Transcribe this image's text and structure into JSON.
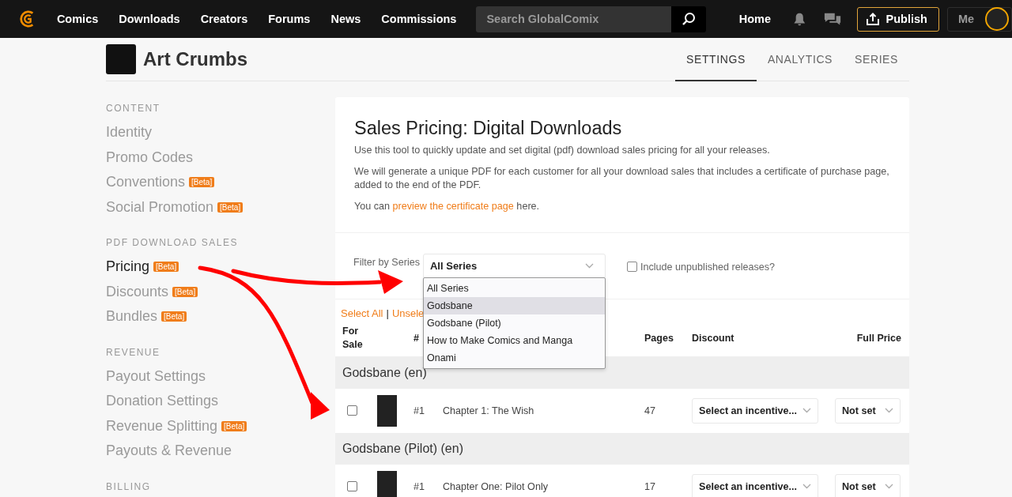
{
  "nav": {
    "links": [
      {
        "label": "Comics"
      },
      {
        "label": "Downloads"
      },
      {
        "label": "Creators"
      },
      {
        "label": "Forums"
      },
      {
        "label": "News"
      },
      {
        "label": "Commissions"
      }
    ],
    "search": {
      "placeholder": "Search GlobalComix"
    },
    "home": "Home",
    "publish": "Publish",
    "me": "Me"
  },
  "creator": {
    "name": "Art Crumbs"
  },
  "tabs": [
    {
      "label": "SETTINGS",
      "selected": true
    },
    {
      "label": "ANALYTICS",
      "selected": false
    },
    {
      "label": "SERIES",
      "selected": false
    }
  ],
  "sidebar": {
    "sections": [
      {
        "heading": "CONTENT",
        "items": [
          {
            "label": "Identity",
            "selected": false
          },
          {
            "label": "Promo Codes",
            "selected": false
          },
          {
            "label": "Conventions",
            "selected": false,
            "badge": "[Beta]"
          },
          {
            "label": "Social Promotion",
            "selected": false,
            "badge": "[Beta]"
          }
        ]
      },
      {
        "heading": "PDF DOWNLOAD SALES",
        "items": [
          {
            "label": "Pricing",
            "selected": true,
            "badge": "[Beta]"
          },
          {
            "label": "Discounts",
            "selected": false,
            "badge": "[Beta]"
          },
          {
            "label": "Bundles",
            "selected": false,
            "badge": "[Beta]"
          }
        ]
      },
      {
        "heading": "REVENUE",
        "items": [
          {
            "label": "Payout Settings",
            "selected": false
          },
          {
            "label": "Donation Settings",
            "selected": false
          },
          {
            "label": "Revenue Splitting",
            "selected": false,
            "badge": "[Beta]"
          },
          {
            "label": "Payouts & Revenue",
            "selected": false
          }
        ]
      },
      {
        "heading": "BILLING"
      }
    ]
  },
  "panel": {
    "title": "Sales Pricing: Digital Downloads",
    "intro": "Use this tool to quickly update and set digital (pdf) download sales pricing for all your releases.",
    "note": "We will generate a unique PDF for each customer for all your download sales that includes a certificate of purchase page, added to the end of the PDF.",
    "preview": {
      "before": "You can",
      "link": "preview the certificate page",
      "after": "here."
    },
    "filter": {
      "label": "Filter by Series",
      "value": "All Series",
      "expanded": true,
      "options": [
        {
          "label": "All Series",
          "highlighted": false
        },
        {
          "label": "Godsbane",
          "highlighted": true
        },
        {
          "label": "Godsbane (Pilot)",
          "highlighted": false
        },
        {
          "label": "How to Make Comics and Manga",
          "highlighted": false
        },
        {
          "label": "Onami",
          "highlighted": false
        }
      ]
    },
    "include_unpublished": {
      "label": "Include unpublished releases?",
      "checked": false
    },
    "select_all": "Select All",
    "separator": "|",
    "unselect": "Unsele",
    "columns": {
      "for_sale": "For Sale",
      "number": "#",
      "pages": "Pages",
      "discount": "Discount",
      "full_price": "Full Price"
    },
    "groups": [
      {
        "title": "Godsbane (en)",
        "releases": [
          {
            "checked": false,
            "number": "#1",
            "title": "Chapter 1: The Wish",
            "pages": "47",
            "discount": "Select an incentive...",
            "full_price": "Not set"
          }
        ]
      },
      {
        "title": "Godsbane (Pilot) (en)",
        "releases": [
          {
            "checked": false,
            "number": "#1",
            "title": "Chapter One: Pilot Only",
            "pages": "17",
            "discount": "Select an incentive...",
            "full_price": "Not set"
          }
        ]
      }
    ]
  }
}
